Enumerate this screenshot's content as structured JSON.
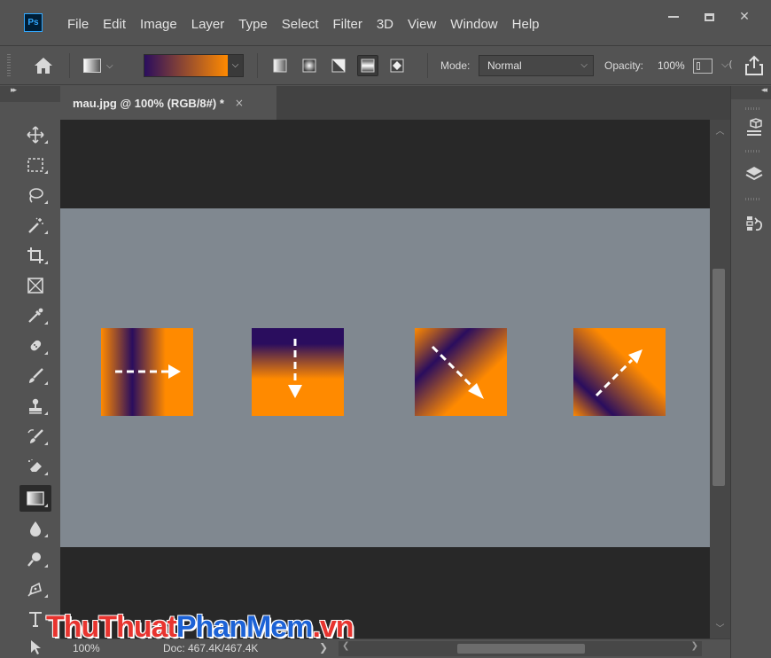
{
  "app": {
    "logo_text": "Ps",
    "menu": [
      "File",
      "Edit",
      "Image",
      "Layer",
      "Type",
      "Select",
      "Filter",
      "3D",
      "View",
      "Window",
      "Help"
    ],
    "window_controls": {
      "close_glyph": "✕"
    }
  },
  "options_bar": {
    "gradient_colors": [
      "#2a0d5e",
      "#ff8a00"
    ],
    "gradient_types": [
      "linear",
      "radial",
      "angle",
      "reflected",
      "diamond"
    ],
    "active_gradient_type": "reflected",
    "mode_label": "Mode:",
    "mode_value": "Normal",
    "opacity_label": "Opacity:",
    "opacity_value": "100%"
  },
  "document": {
    "tab_title": "mau.jpg @ 100% (RGB/8#) *",
    "tab_close_glyph": "×",
    "canvas_color": "#808890",
    "pasteboard_color": "#282828",
    "gradient_samples": [
      {
        "name": "left-to-right",
        "type": "reflected",
        "direction": "horizontal",
        "colors": [
          "#2a0d5e",
          "#ff8a00"
        ]
      },
      {
        "name": "top-to-bottom",
        "type": "reflected",
        "direction": "vertical",
        "colors": [
          "#2a0d5e",
          "#ff8a00"
        ]
      },
      {
        "name": "diagonal-down",
        "type": "reflected",
        "direction": "diagonal-down-right",
        "colors": [
          "#2a0d5e",
          "#ff8a00"
        ]
      },
      {
        "name": "diagonal-up",
        "type": "reflected",
        "direction": "diagonal-up-right",
        "colors": [
          "#2a0d5e",
          "#ff8a00"
        ]
      }
    ]
  },
  "toolbox": {
    "tools": [
      "move",
      "marquee",
      "lasso",
      "magic-wand",
      "crop",
      "frame",
      "eyedropper",
      "healing-brush",
      "brush",
      "clone-stamp",
      "history-brush",
      "eraser",
      "gradient",
      "blur",
      "dodge",
      "pen",
      "type",
      "path-selection"
    ],
    "active_tool": "gradient"
  },
  "right_dock": {
    "panels": [
      "3d",
      "layers",
      "history"
    ]
  },
  "status": {
    "zoom": "100%",
    "doc_info": "Doc: 467.4K/467.4K",
    "arrow_glyph": "❯"
  },
  "watermark": {
    "part1": "ThuThuat",
    "part2": "PhanMem",
    "part3": ".vn"
  }
}
